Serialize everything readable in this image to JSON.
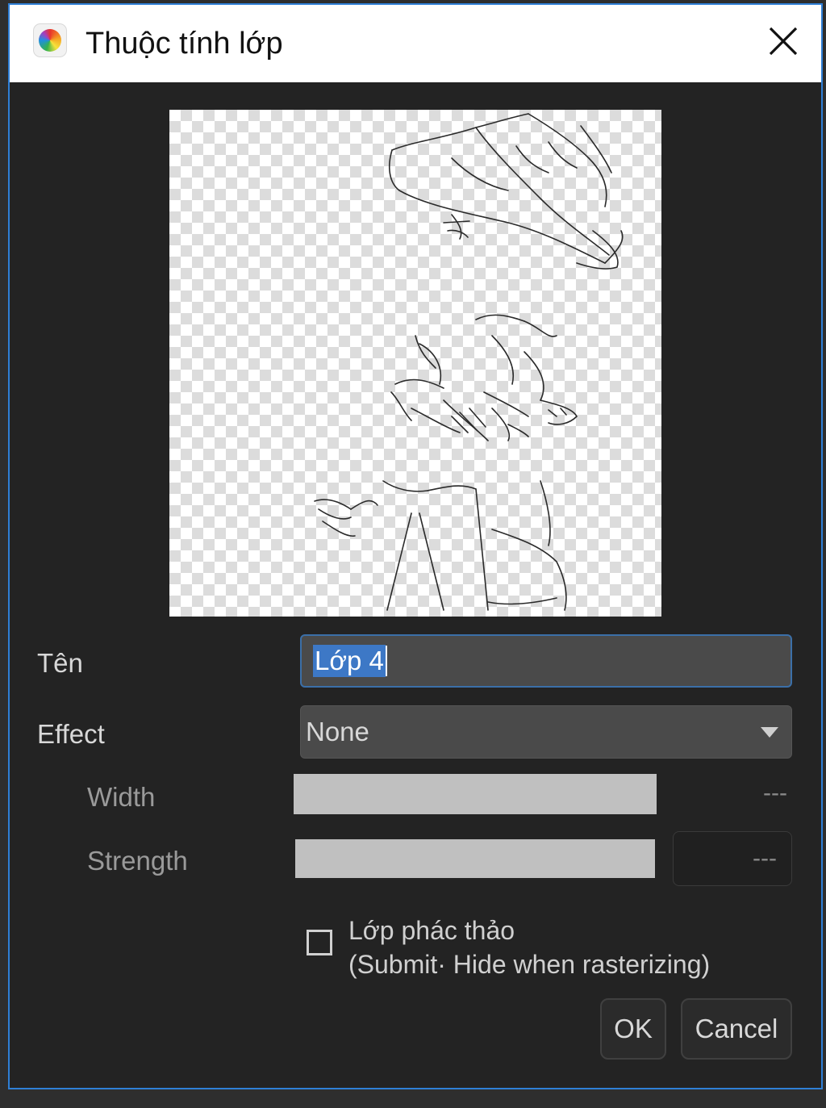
{
  "window": {
    "title": "Thuộc tính lớp"
  },
  "form": {
    "name_label": "Tên",
    "name_value": "Lớp 4",
    "effect_label": "Effect",
    "effect_value": "None",
    "width_label": "Width",
    "width_value": "---",
    "strength_label": "Strength",
    "strength_value": "---",
    "draft_checkbox_line1": "Lớp phác thảo",
    "draft_checkbox_line2": "(Submit· Hide when rasterizing)",
    "draft_checked": false
  },
  "buttons": {
    "ok": "OK",
    "cancel": "Cancel"
  },
  "colors": {
    "dialog_bg": "#232323",
    "accent_border": "#2f7fd6",
    "selection": "#3d78c6"
  }
}
